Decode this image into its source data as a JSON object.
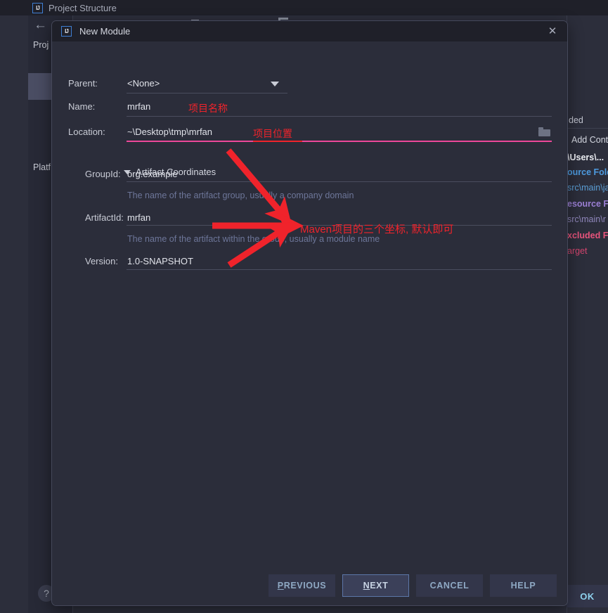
{
  "background_window": {
    "title": "Project Structure",
    "logo_icon": "intellij-idea-logo-icon",
    "back_icon": "back-arrow-icon",
    "sidebar": {
      "group_project": "Proj",
      "group_platform": "Platf"
    },
    "right_panel": {
      "excluded_label": "ded",
      "add_content_root": "Add Cont",
      "content_path": "\\Users\\...",
      "source_folders_label": "ource Fold",
      "source_folders_path": "src\\main\\ja",
      "resource_folders_label": "esource F",
      "resource_folders_path": "src\\main\\r",
      "excluded_folders_label": "xcluded F",
      "excluded_folders_path": "arget"
    },
    "ok_button": "OK",
    "help_button": "?"
  },
  "dialog": {
    "title": "New Module",
    "logo_icon": "intellij-idea-logo-icon",
    "close_icon": "close-icon",
    "fields": {
      "parent": {
        "label": "Parent:",
        "value": "<None>",
        "dropdown_icon": "chevron-down-icon"
      },
      "name": {
        "label": "Name:",
        "value": "mrfan"
      },
      "location": {
        "label": "Location:",
        "value": "~\\Desktop\\tmp\\mrfan",
        "browse_icon": "folder-icon"
      }
    },
    "artifact_coordinates": {
      "section_label": "Artifact Coordinates",
      "expand_icon": "triangle-down-icon",
      "group_id": {
        "label": "GroupId:",
        "value": "org.example",
        "hint": "The name of the artifact group, usually a company domain"
      },
      "artifact_id": {
        "label": "ArtifactId:",
        "value": "mrfan",
        "hint": "The name of the artifact within the group, usually a module name"
      },
      "version": {
        "label": "Version:",
        "value": "1.0-SNAPSHOT"
      }
    },
    "buttons": {
      "previous": "PREVIOUS",
      "previous_mnemonic": "P",
      "previous_rest": "REVIOUS",
      "next": "NEXT",
      "next_mnemonic": "N",
      "next_rest": "EXT",
      "cancel": "CANCEL",
      "help": "HELP"
    }
  },
  "annotations": {
    "name_note": "项目名称",
    "location_note": "项目位置",
    "coordinates_note": "Maven项目的三个坐标, 默认即可",
    "arrow_color": "#f0232b",
    "text_color": "#f0232b",
    "location_underline_color": "#ec4899"
  },
  "colors": {
    "dialog_bg": "#2b2d3a",
    "titlebar_bg": "#1f2029",
    "window_bg": "#2c2e3b",
    "accent_blue": "#4d9be0",
    "accent_purple": "#9b7fd4",
    "accent_pink": "#e8547c",
    "button_bg": "#33364a",
    "button_focus_bg": "#3b4059"
  }
}
